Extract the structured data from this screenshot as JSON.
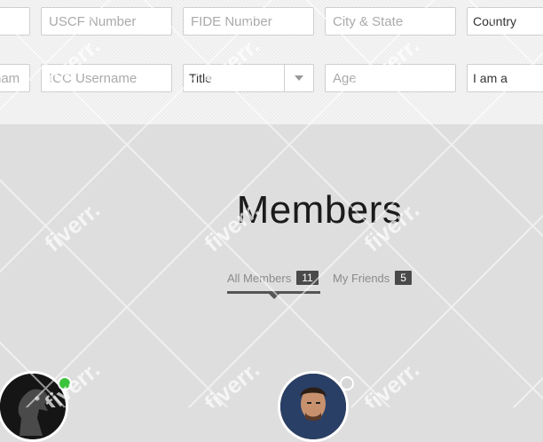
{
  "search": {
    "row1": {
      "first_partial_placeholder": "",
      "uscf_placeholder": "USCF Number",
      "fide_placeholder": "FIDE Number",
      "city_placeholder": "City & State",
      "country_label": "Country"
    },
    "row2": {
      "username_partial_placeholder": "nam",
      "icc_placeholder": "ICC Username",
      "title_label": "Title",
      "age_placeholder": "Age",
      "iama_label": "I am a"
    }
  },
  "page": {
    "title": "Members"
  },
  "tabs": [
    {
      "label": "All Members",
      "count": "11",
      "active": true
    },
    {
      "label": "My Friends",
      "count": "5",
      "active": false
    }
  ],
  "members": [
    {
      "avatar": "knight-avatar",
      "status": "online",
      "status_color": "#3cc33c"
    },
    {
      "avatar": "man-portrait-avatar",
      "status": "offline",
      "status_color": "#d7d7d7"
    }
  ],
  "watermark": {
    "text": "fiverr."
  }
}
